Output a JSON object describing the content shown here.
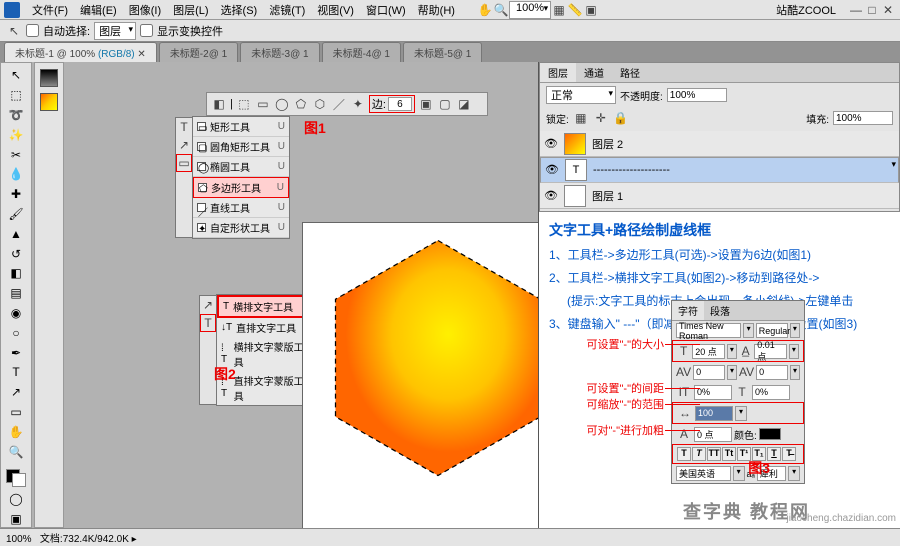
{
  "menubar": [
    "文件(F)",
    "编辑(E)",
    "图像(I)",
    "图层(L)",
    "选择(S)",
    "滤镜(T)",
    "视图(V)",
    "窗口(W)",
    "帮助(H)"
  ],
  "zoom_in_top": "100%",
  "branding": "站酷ZCOOL",
  "optbar": {
    "selector": "图层",
    "label1": "自动选择:",
    "label2": "显示变换控件"
  },
  "tabs": [
    {
      "label": "未标题-1 @ 100%",
      "sub": "(RGB/8)",
      "active": true
    },
    {
      "label": "未标题-2@ 1",
      "active": false
    },
    {
      "label": "未标题-3@ 1",
      "active": false
    },
    {
      "label": "未标题-4@ 1",
      "active": false
    },
    {
      "label": "未标题-5@ 1",
      "active": false
    }
  ],
  "shapeopt": {
    "sides_label": "边:",
    "sides_value": "6"
  },
  "flyout_shapes": [
    {
      "n": "矩形工具",
      "k": "U"
    },
    {
      "n": "圆角矩形工具",
      "k": "U"
    },
    {
      "n": "椭圆工具",
      "k": "U"
    },
    {
      "n": "多边形工具",
      "k": "U",
      "sel": true
    },
    {
      "n": "直线工具",
      "k": "U"
    },
    {
      "n": "自定形状工具",
      "k": "U"
    }
  ],
  "flyout_text": [
    {
      "n": "横排文字工具",
      "sel": true
    },
    {
      "n": "直排文字工具"
    },
    {
      "n": "横排文字蒙版工具"
    },
    {
      "n": "直排文字蒙版工具"
    }
  ],
  "callouts": {
    "fig1": "图1",
    "fig2": "图2",
    "fig3": "图3"
  },
  "layers_panel": {
    "tabs": [
      "图层",
      "通道",
      "路径"
    ],
    "blend": "正常",
    "opacity_l": "不透明度:",
    "opacity_v": "100%",
    "lock_l": "锁定:",
    "fill_l": "填充:",
    "fill_v": "100%",
    "rows": [
      {
        "name": "图层 2",
        "thumb": "grad"
      },
      {
        "name": "---------------------",
        "thumb": "T",
        "sel": true
      },
      {
        "name": "图层 1",
        "thumb": "blank"
      }
    ]
  },
  "guide": {
    "title": "文字工具+路径绘制虚线框",
    "l1": "1、工具栏->多边形工具(可选)->设置为6边(如图1)",
    "l2": "2、工具栏->横排文字工具(如图2)->移动到路径处->",
    "l2b": "(提示:文字工具的标志上会出现一条小斜线)->左键单击",
    "l3": "3、键盘输入\" ---\"（即减号）->输入完进行字符设置(如图3)"
  },
  "char": {
    "tabs": [
      "字符",
      "段落"
    ],
    "font": "Times New Roman",
    "style": "Regular",
    "size": "20 点",
    "leading": "0.01 点",
    "tracking": "0",
    "kern": "0",
    "vscale": "0%",
    "baseline": "0%",
    "hscale": "100",
    "other": "0 点",
    "color_l": "颜色:",
    "lang": "美国英语",
    "aa": "犀利"
  },
  "annos": {
    "a1": "可设置\"-\"的大小",
    "a2": "可设置\"-\"的间距",
    "a3": "可缩放\"-\"的范围",
    "a4": "可对\"-\"进行加粗"
  },
  "status": {
    "zoom": "100%",
    "doc": "文档:732.4K/942.0K"
  },
  "credit": "查字典 教程网",
  "credit2": "jiaocheng.chazidian.com"
}
